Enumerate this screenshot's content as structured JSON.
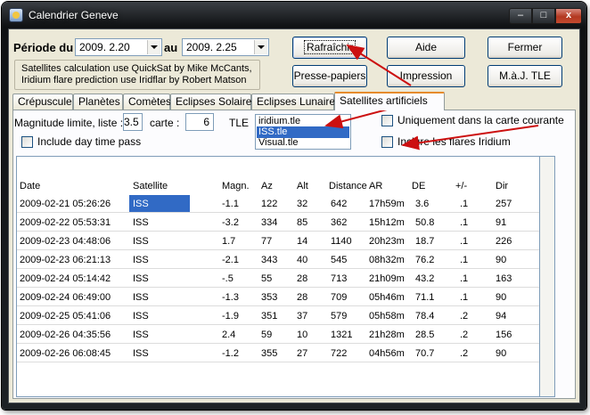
{
  "window": {
    "title": "Calendrier Geneve",
    "controls": {
      "minimize": "–",
      "maximize": "□",
      "close": "x"
    }
  },
  "period": {
    "label": "Période du",
    "from": "2009. 2.20",
    "to_label": "au",
    "to": "2009. 2.25"
  },
  "info_text": [
    "Satellites calculation use QuickSat by Mike McCants,",
    "Iridium flare prediction use Iridflar by Robert Matson"
  ],
  "buttons": {
    "refresh": "Rafraîchir",
    "help": "Aide",
    "close": "Fermer",
    "clipboard": "Presse-papiers",
    "print": "Impression",
    "update_tle": "M.à.J. TLE"
  },
  "tabs": [
    "Crépuscule",
    "Planètes",
    "Comètes",
    "Eclipses Solaires",
    "Eclipses Lunaires",
    "Satellites artificiels"
  ],
  "active_tab": "Satellites artificiels",
  "filters": {
    "magnitude_label": "Magnitude limite, liste :",
    "magnitude_value": "3.5",
    "map_label": "carte :",
    "map_value": "6",
    "tle_label": "TLE",
    "tle_files": [
      "iridium.tle",
      "ISS.tle",
      "Visual.tle"
    ],
    "tle_selected": "ISS.tle",
    "only_in_map_label": "Uniquement dans la carte courante",
    "include_iridium_label": "Inclure les flares Iridium",
    "include_daytime_label": "Include day time pass"
  },
  "table": {
    "columns": [
      "Date",
      "Satellite",
      "Magn.",
      "Az",
      "Alt",
      "Distance",
      "AR",
      "DE",
      "+/-",
      "Dir"
    ],
    "rows": [
      [
        "2009-02-21 05:26:26",
        "ISS",
        "-1.1",
        "122",
        "32",
        "642",
        "17h59m",
        "3.6",
        ".1",
        "257"
      ],
      [
        "2009-02-22 05:53:31",
        "ISS",
        "-3.2",
        "334",
        "85",
        "362",
        "15h12m",
        "50.8",
        ".1",
        "91"
      ],
      [
        "2009-02-23 04:48:06",
        "ISS",
        "1.7",
        "77",
        "14",
        "1140",
        "20h23m",
        "18.7",
        ".1",
        "226"
      ],
      [
        "2009-02-23 06:21:13",
        "ISS",
        "-2.1",
        "343",
        "40",
        "545",
        "08h32m",
        "76.2",
        ".1",
        "90"
      ],
      [
        "2009-02-24 05:14:42",
        "ISS",
        "-.5",
        "55",
        "28",
        "713",
        "21h09m",
        "43.2",
        ".1",
        "163"
      ],
      [
        "2009-02-24 06:49:00",
        "ISS",
        "-1.3",
        "353",
        "28",
        "709",
        "05h46m",
        "71.1",
        ".1",
        "90"
      ],
      [
        "2009-02-25 05:41:06",
        "ISS",
        "-1.9",
        "351",
        "37",
        "579",
        "05h58m",
        "78.4",
        ".2",
        "94"
      ],
      [
        "2009-02-26 04:35:56",
        "ISS",
        "2.4",
        "59",
        "10",
        "1321",
        "21h28m",
        "28.5",
        ".2",
        "156"
      ],
      [
        "2009-02-26 06:08:45",
        "ISS",
        "-1.2",
        "355",
        "27",
        "722",
        "04h56m",
        "70.7",
        ".2",
        "90"
      ]
    ]
  },
  "colors": {
    "selection": "#316ac5",
    "tab_accent": "#e68b2c",
    "annotation_arrow": "#cc1010",
    "dialog_face": "#ece9d8"
  }
}
